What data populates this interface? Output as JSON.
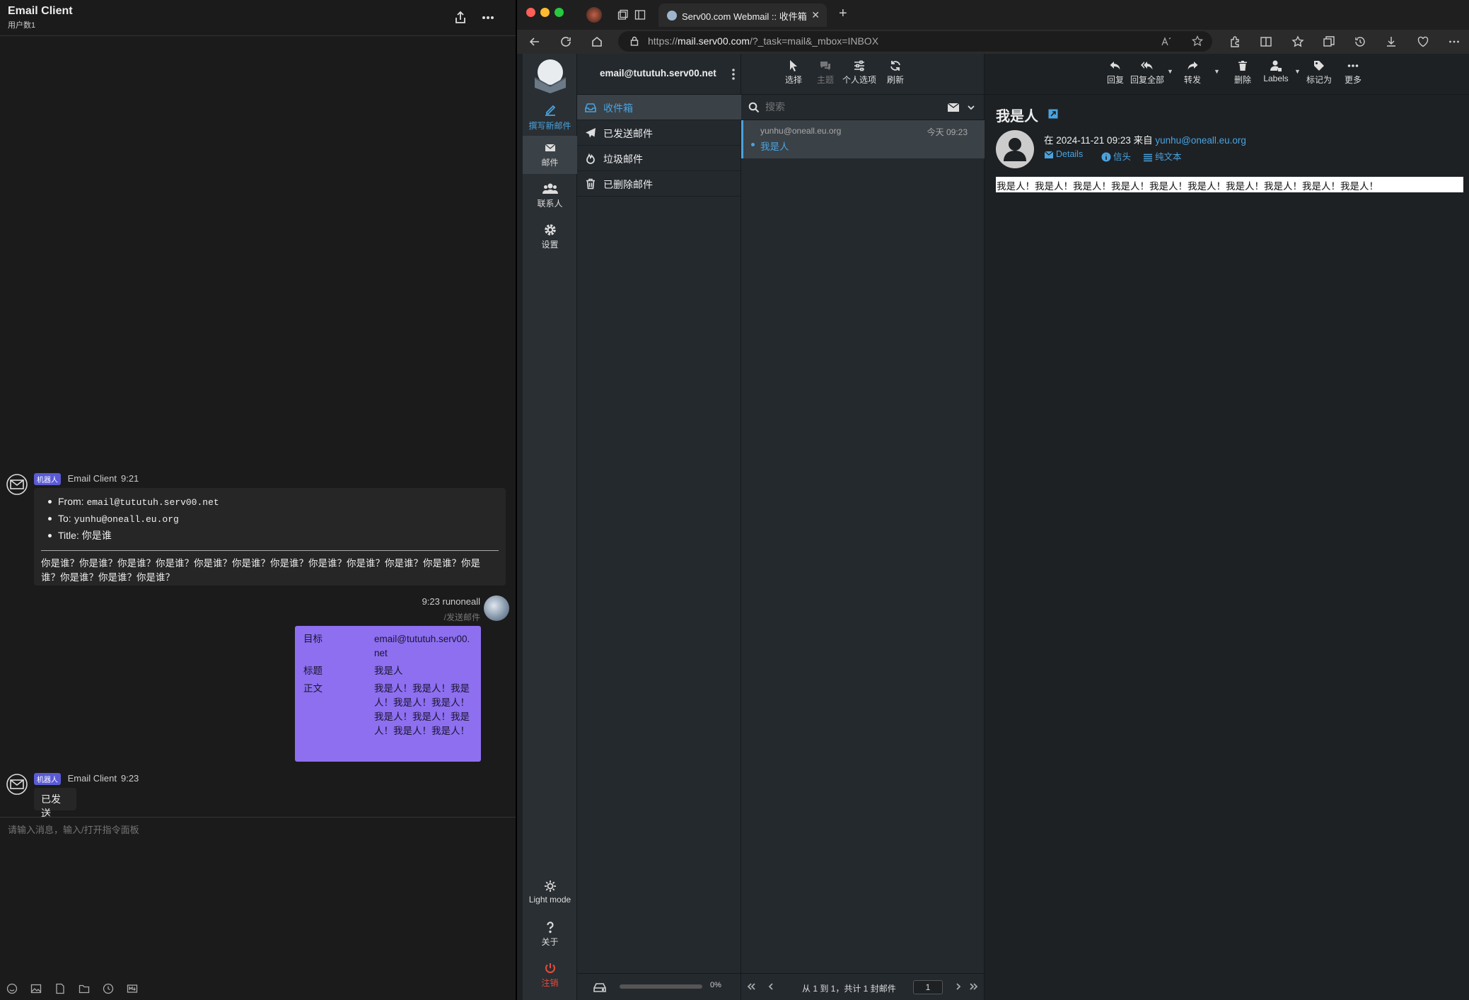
{
  "chat": {
    "title": "Email Client",
    "subtitle": "用户数1",
    "msg1": {
      "badge": "机器人",
      "sender": "Email Client",
      "time": "9:21",
      "from_label": "From:",
      "from_value": "email@tututuh.serv00.net",
      "to_label": "To:",
      "to_value": "yunhu@oneall.eu.org",
      "title_label": "Title:",
      "title_value": "你是谁",
      "body": "你是谁？你是谁？你是谁？你是谁？你是谁？你是谁？你是谁？你是谁？你是谁？你是谁？你是谁？你是谁？你是谁？你是谁？你是谁？"
    },
    "msg2": {
      "time": "9:23",
      "sender": "runoneall",
      "command": "/发送邮件",
      "rows": [
        {
          "key": "目标",
          "value": "email@tututuh.serv00.net"
        },
        {
          "key": "标题",
          "value": "我是人"
        },
        {
          "key": "正文",
          "value": "我是人！我是人！我是人！我是人！我是人！我是人！我是人！我是人！我是人！我是人！"
        }
      ]
    },
    "msg3": {
      "badge": "机器人",
      "sender": "Email Client",
      "time": "9:23",
      "text": "已发送"
    },
    "input_placeholder": "请输入消息，输入/打开指令面板"
  },
  "browser": {
    "tab_title": "Serv00.com Webmail :: 收件箱",
    "url_prefix": "https://",
    "url_host": "mail.serv00.com",
    "url_rest": "/?_task=mail&_mbox=INBOX"
  },
  "webmail": {
    "nav": {
      "compose": "撰写新邮件",
      "mail": "邮件",
      "contacts": "联系人",
      "settings": "设置",
      "light_mode": "Light mode",
      "about": "关于",
      "logout": "注销"
    },
    "account": "email@tututuh.serv00.net",
    "folders": [
      {
        "label": "收件箱",
        "icon": "inbox-icon"
      },
      {
        "label": "已发送邮件",
        "icon": "paper-plane-icon"
      },
      {
        "label": "垃圾邮件",
        "icon": "fire-icon"
      },
      {
        "label": "已删除邮件",
        "icon": "trash-icon"
      }
    ],
    "quota_percent": "0%",
    "quota_fraction": 0.0,
    "list_toolbar": {
      "select": "选择",
      "thread": "主题",
      "options": "个人选项",
      "refresh": "刷新"
    },
    "search_placeholder": "搜索",
    "messages": [
      {
        "from": "yunhu@oneall.eu.org",
        "date": "今天 09:23",
        "subject": "我是人"
      }
    ],
    "list_footer": {
      "count_text": "从 1 到 1，共计 1 封邮件",
      "page": "1"
    },
    "read_toolbar": {
      "reply": "回复",
      "reply_all": "回复全部",
      "forward": "转发",
      "delete": "删除",
      "labels": "Labels",
      "mark": "标记为",
      "more": "更多"
    },
    "message": {
      "subject": "我是人",
      "headline_prefix": "在 2024-11-21 09:23 来自",
      "sender": "yunhu@oneall.eu.org",
      "details": "Details",
      "headers": "信头",
      "plain_text": "纯文本",
      "body": "我是人！我是人！我是人！我是人！我是人！我是人！我是人！我是人！我是人！我是人！"
    }
  },
  "colors": {
    "accent": "#4aa3df",
    "bot_badge": "#5b5bd6",
    "command_card": "#8d6ff0",
    "logout": "#e74c3c"
  }
}
